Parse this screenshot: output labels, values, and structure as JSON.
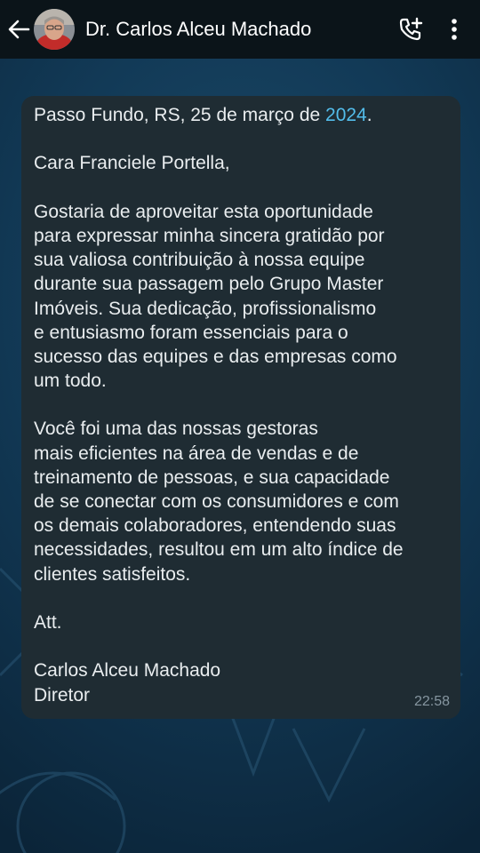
{
  "header": {
    "contact_name": "Dr. Carlos Alceu Machado",
    "back_icon": "arrow-left-icon",
    "add_call_icon": "phone-plus-icon",
    "menu_icon": "more-vertical-icon",
    "background_color": "#0b1419"
  },
  "message": {
    "date_line_prefix": "Passo Fundo, RS, 25 de março de ",
    "date_line_year": "2024",
    "date_line_suffix": ".",
    "greeting": "Cara Franciele Portella,",
    "paragraph1": [
      "Gostaria de aproveitar esta oportunidade",
      "para expressar minha sincera gratidão por",
      "sua valiosa contribuição à nossa equipe",
      "durante sua passagem pelo Grupo Master",
      "Imóveis. Sua dedicação, profissionalismo",
      "e entusiasmo foram essenciais para o",
      "sucesso das equipes e das empresas como",
      "um todo."
    ],
    "paragraph2": [
      "Você foi uma das nossas gestoras",
      "mais eficientes na área de vendas e de",
      "treinamento de pessoas, e sua capacidade",
      "de se conectar com os consumidores e com",
      "os demais colaboradores, entendendo suas",
      "necessidades, resultou em um alto índice de",
      "clientes satisfeitos."
    ],
    "closing": "Att.",
    "signature_name": "Carlos Alceu Machado",
    "signature_title": "Diretor",
    "time": "22:58",
    "bubble_color": "#1f2c33",
    "link_color": "#53bdeb"
  }
}
